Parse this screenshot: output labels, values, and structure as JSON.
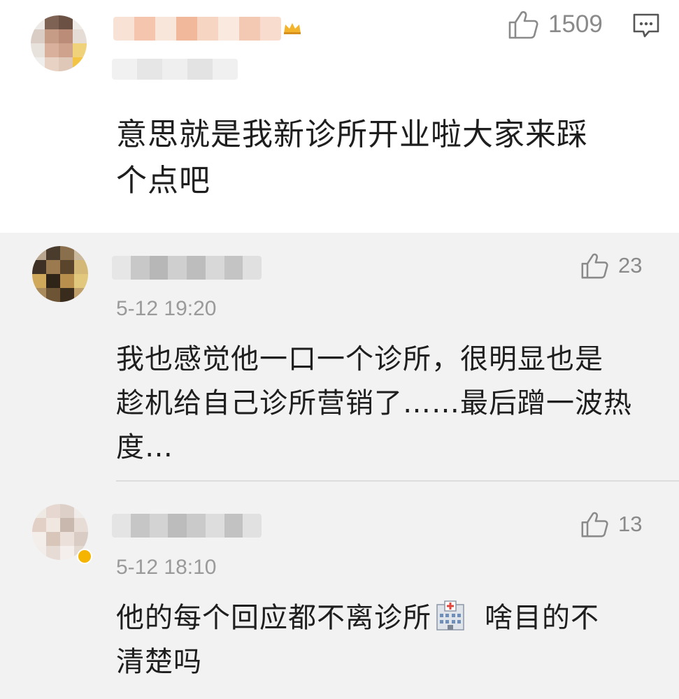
{
  "main_comment": {
    "likes": "1509",
    "text_line1": "意思就是我新诊所开业啦大家来踩",
    "text_line2": "个点吧",
    "icons": [
      "thumbs-up-icon",
      "comment-bubble-icon",
      "vip-crown-icon"
    ]
  },
  "replies": [
    {
      "likes": "23",
      "time": "5-12 19:20",
      "text_line1": "我也感觉他一口一个诊所，很明显也是",
      "text_line2": "趁机给自己诊所营销了……最后蹭一波热",
      "text_line3": "度…"
    },
    {
      "likes": "13",
      "time": "5-12 18:10",
      "text_before_emoji": "他的每个回应都不离诊所",
      "emoji": "hospital-emoji",
      "text_after_emoji": "啥目的不",
      "text_line2": "清楚吗"
    }
  ],
  "colors": {
    "main_bg": "#ffffff",
    "reply_bg": "#f2f2f2",
    "text": "#1e1e1e",
    "muted": "#8a8a8a",
    "badge": "#f5b400"
  }
}
